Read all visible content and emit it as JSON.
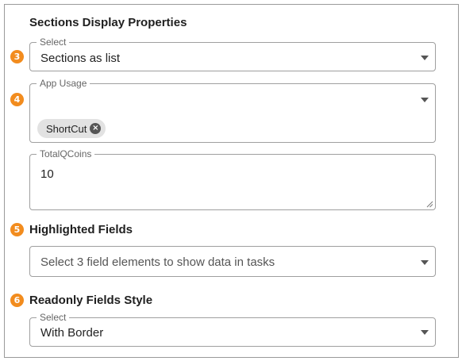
{
  "title": "Sections Display Properties",
  "badges": [
    "3",
    "4",
    "5",
    "6"
  ],
  "display_select": {
    "legend": "Select",
    "value": "Sections as list"
  },
  "app_usage": {
    "legend": "App Usage",
    "chips": [
      "ShortCut"
    ]
  },
  "total_qcoins": {
    "legend": "TotalQCoins",
    "value": "10"
  },
  "highlighted_fields": {
    "heading": "Highlighted Fields",
    "placeholder": "Select 3 field elements to show data in tasks"
  },
  "readonly_style": {
    "heading": "Readonly Fields Style",
    "legend": "Select",
    "value": "With Border"
  },
  "colors": {
    "badge": "#f28c1e",
    "chip": "#e2e2e2",
    "border": "#9f9f9f"
  },
  "icons": {
    "caret": "chevron-down-icon",
    "chip_remove": "close-circle-icon",
    "resize": "resize-grip-icon"
  }
}
